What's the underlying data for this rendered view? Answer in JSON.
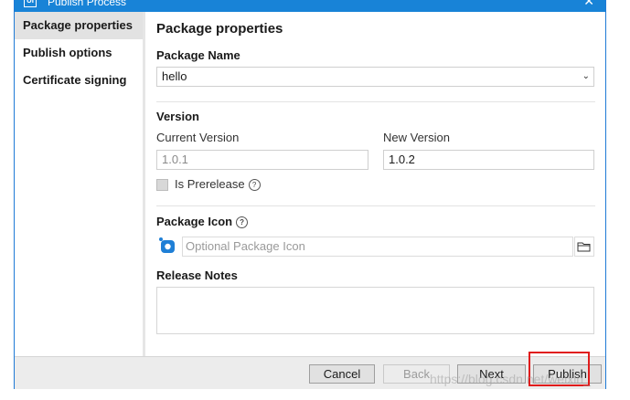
{
  "window": {
    "title": "Publish Process",
    "title_icon": "UI",
    "close": "✕"
  },
  "sidebar": {
    "items": [
      {
        "label": "Package properties",
        "active": true
      },
      {
        "label": "Publish options",
        "active": false
      },
      {
        "label": "Certificate signing",
        "active": false
      }
    ]
  },
  "main": {
    "heading": "Package properties",
    "package_name": {
      "label": "Package Name",
      "value": "hello"
    },
    "version": {
      "section_label": "Version",
      "current_label": "Current Version",
      "current_value": "1.0.1",
      "new_label": "New Version",
      "new_value": "1.0.2",
      "prerelease_label": "Is Prerelease",
      "prerelease_checked": false
    },
    "package_icon": {
      "label": "Package Icon",
      "placeholder": "Optional Package Icon"
    },
    "release_notes": {
      "label": "Release Notes",
      "value": ""
    }
  },
  "footer": {
    "cancel": "Cancel",
    "back": "Back",
    "next": "Next",
    "publish": "Publish"
  },
  "watermark": "https://blog.csdn.net/weixin_"
}
